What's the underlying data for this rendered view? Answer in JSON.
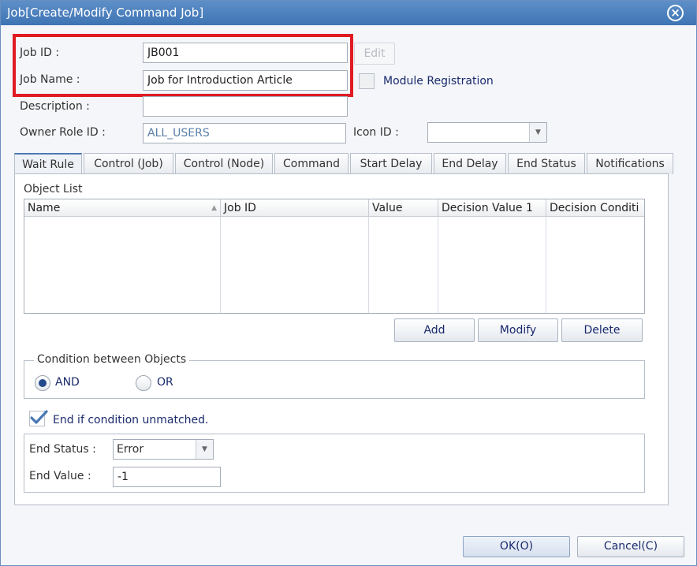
{
  "window": {
    "title": "Job[Create/Modify Command Job]"
  },
  "form": {
    "job_id_label": "Job ID :",
    "job_id_value": "JB001",
    "edit_button": "Edit",
    "job_name_label": "Job Name :",
    "job_name_value": "Job for Introduction Article",
    "module_registration_label": "Module Registration",
    "description_label": "Description :",
    "description_value": "",
    "owner_role_label": "Owner Role ID :",
    "owner_role_value": "ALL_USERS",
    "icon_id_label": "Icon ID :",
    "icon_id_value": ""
  },
  "tabs": [
    {
      "label": "Wait Rule"
    },
    {
      "label": "Control (Job)"
    },
    {
      "label": "Control (Node)"
    },
    {
      "label": "Command"
    },
    {
      "label": "Start Delay"
    },
    {
      "label": "End Delay"
    },
    {
      "label": "End Status"
    },
    {
      "label": "Notifications"
    }
  ],
  "wait_rule": {
    "object_list_label": "Object List",
    "columns": [
      "Name",
      "Job ID",
      "Value",
      "Decision Value 1",
      "Decision Conditi"
    ],
    "add_button": "Add",
    "modify_button": "Modify",
    "delete_button": "Delete",
    "condition_legend": "Condition between Objects",
    "and_label": "AND",
    "or_label": "OR",
    "end_if_unmatched_label": "End if condition unmatched.",
    "end_status_label": "End Status :",
    "end_status_value": "Error",
    "end_value_label": "End Value :",
    "end_value_value": "-1"
  },
  "footer": {
    "ok_button": "OK(O)",
    "cancel_button": "Cancel(C)"
  },
  "colors": {
    "title_bar": "#4a7fbd",
    "highlight_box": "#e01b22",
    "accent_text": "#1a2a6c"
  }
}
